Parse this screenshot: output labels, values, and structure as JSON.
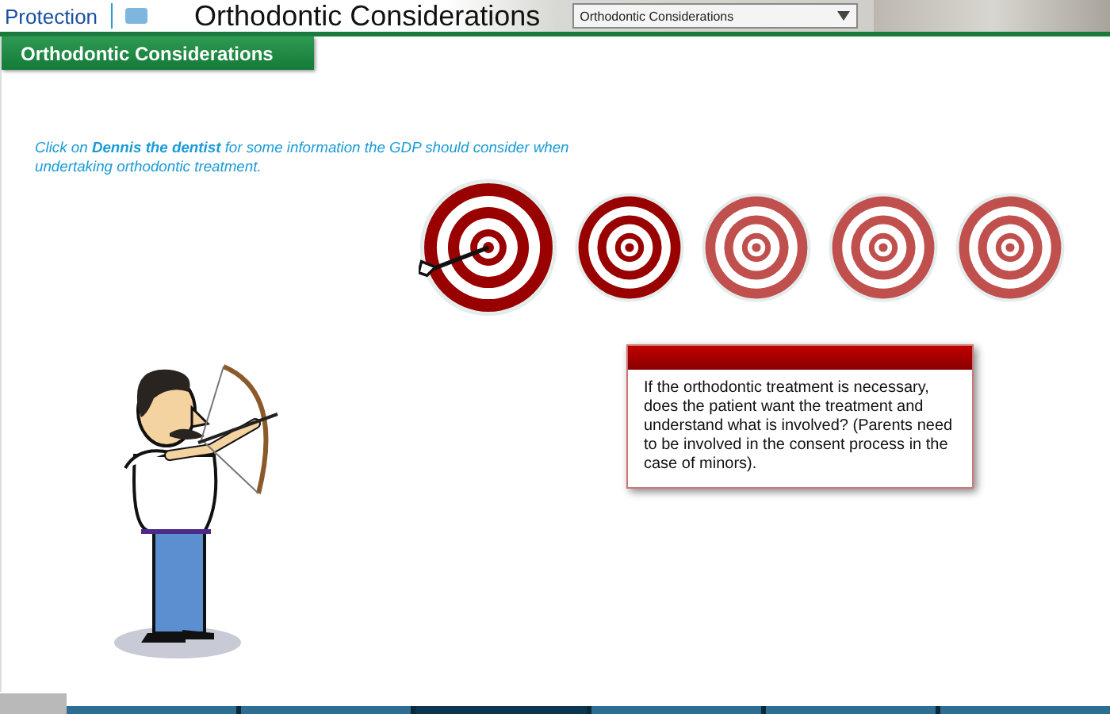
{
  "header": {
    "brand": "Protection",
    "title": "Orthodontic Considerations",
    "dropdown": {
      "value": "Orthodontic Considerations"
    }
  },
  "section_tab": {
    "label": "Orthodontic Considerations"
  },
  "intro": "Click on **Dennis the dentist** for some information the GDP should consider when undertaking orthodontic treatment.",
  "targets": [
    {
      "selected": true,
      "visited": true
    },
    {
      "selected": false,
      "visited": true
    },
    {
      "selected": false,
      "visited": false
    },
    {
      "selected": false,
      "visited": false
    },
    {
      "selected": false,
      "visited": false
    }
  ],
  "info_box": {
    "text": "If the orthodontic treatment is necessary, does the patient want the treatment and understand what is involved? (Parents need to be involved in the consent process in the case of minors)."
  },
  "nav_segments": [
    {
      "selected": false
    },
    {
      "selected": false
    },
    {
      "selected": true
    },
    {
      "selected": false
    },
    {
      "selected": false
    },
    {
      "selected": false
    }
  ]
}
